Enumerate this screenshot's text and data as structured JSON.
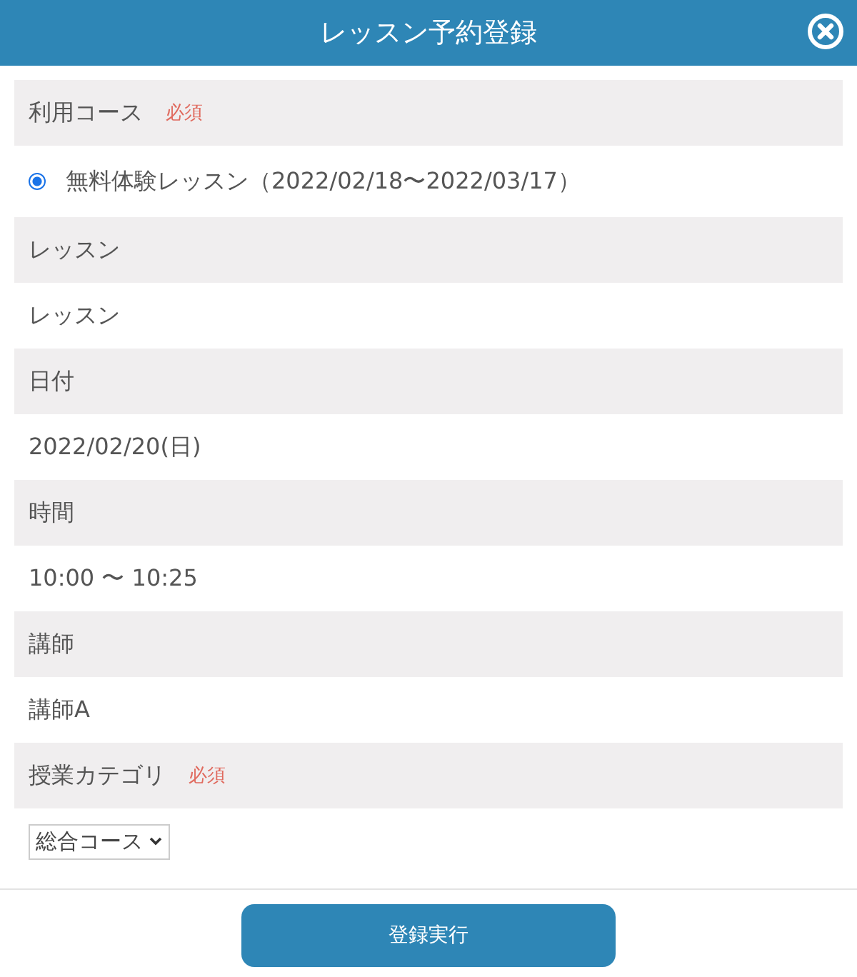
{
  "dialog": {
    "title": "レッスン予約登録"
  },
  "sections": [
    {
      "label": "利用コース",
      "badge": "必須",
      "kind": "radio",
      "options": [
        {
          "label": "無料体験レッスン（2022/02/18〜2022/03/17）",
          "selected": true
        }
      ]
    },
    {
      "label": "レッスン",
      "kind": "text",
      "value": "レッスン"
    },
    {
      "label": "日付",
      "kind": "text",
      "value": "2022/02/20(日)"
    },
    {
      "label": "時間",
      "kind": "text",
      "value": "10:00 〜 10:25"
    },
    {
      "label": "講師",
      "kind": "text",
      "value": "講師A"
    },
    {
      "label": "授業カテゴリ",
      "badge": "必須",
      "kind": "select",
      "value": "総合コース"
    }
  ],
  "submit_button": "登録実行"
}
